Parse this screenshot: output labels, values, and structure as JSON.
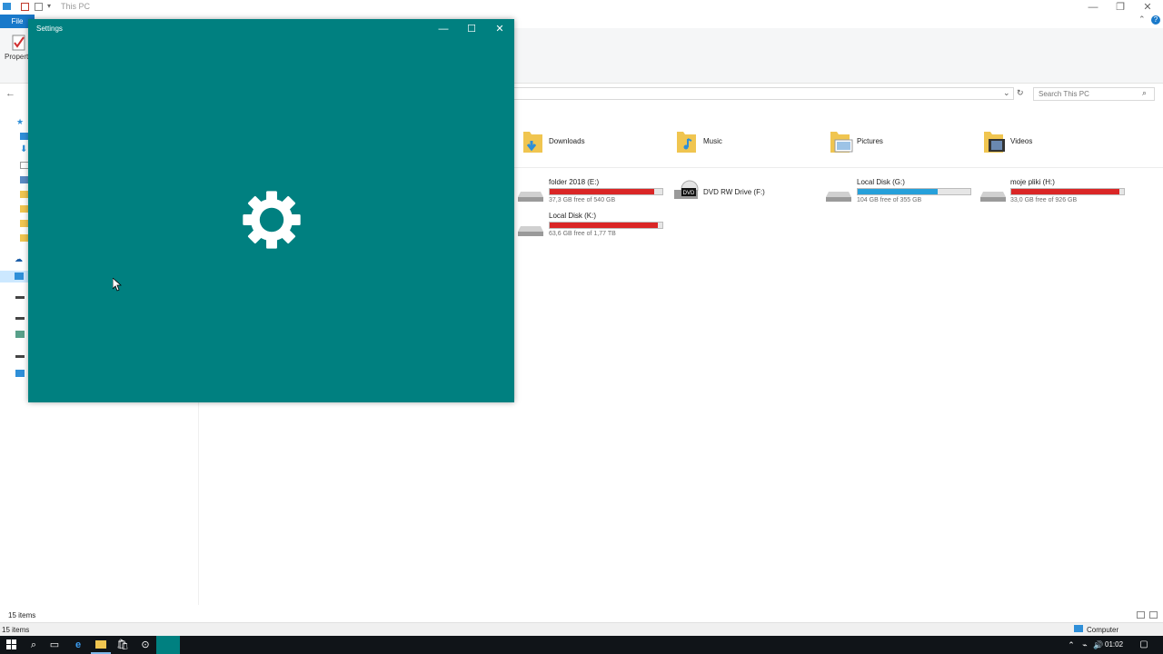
{
  "explorer": {
    "title": "This PC",
    "ribbon_file_tab": "File",
    "properties_label": "Propert",
    "search_placeholder": "Search This PC",
    "folders": [
      {
        "name": "Downloads",
        "icon": "downloads-folder-icon"
      },
      {
        "name": "Music",
        "icon": "music-folder-icon"
      },
      {
        "name": "Pictures",
        "icon": "pictures-folder-icon"
      },
      {
        "name": "Videos",
        "icon": "videos-folder-icon"
      }
    ],
    "drives": [
      {
        "name": "folder 2018 (E:)",
        "free": "37,3 GB free of 540 GB",
        "used_fraction": 0.93,
        "bar_color": "#da2626"
      },
      {
        "name": "DVD RW Drive (F:)",
        "free": "",
        "dvd_label": "DVD"
      },
      {
        "name": "Local Disk (G:)",
        "free": "104 GB free of 355 GB",
        "used_fraction": 0.71,
        "bar_color": "#26a0da"
      },
      {
        "name": "moje pliki (H:)",
        "free": "33,0 GB free of 926 GB",
        "used_fraction": 0.96,
        "bar_color": "#da2626"
      },
      {
        "name": "Local Disk (K:)",
        "free": "63,6 GB free of 1,77 TB",
        "used_fraction": 0.96,
        "bar_color": "#da2626"
      }
    ],
    "status_items": "15 items",
    "status_location": "Computer"
  },
  "settings": {
    "title": "Settings",
    "background": "#008080",
    "icon": "gear-icon"
  },
  "taskbar": {
    "clock": "01:02"
  }
}
